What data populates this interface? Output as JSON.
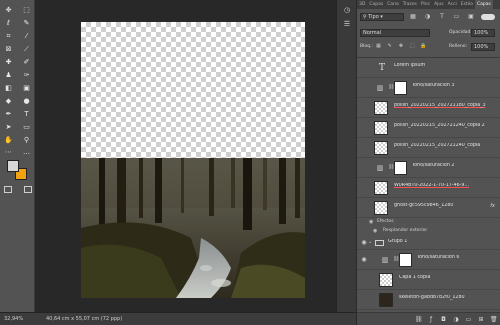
{
  "toolbar": {
    "tools": [
      "move",
      "marquee",
      "lasso",
      "quick-select",
      "crop",
      "eyedropper",
      "healing",
      "brush",
      "stamp",
      "history-brush",
      "eraser",
      "gradient",
      "blur",
      "dodge",
      "pen",
      "type",
      "path-select",
      "shape",
      "hand",
      "zoom",
      "more"
    ],
    "foreground_color": "#d8d8d8",
    "background_color": "#f2a30f"
  },
  "status": {
    "zoom": "32,94%",
    "dimensions": "40,64 cm x 55,07 cm (72 ppp)"
  },
  "panel": {
    "tabs": [
      "3D",
      "Capas",
      "Cana",
      "Trazos",
      "Pinc",
      "Ajus",
      "Acci",
      "Estilo",
      "Capas"
    ],
    "active_tab": "Capas",
    "filter_kind": "Tipo",
    "blend_mode": "Normal",
    "opacity_label": "Opacidad:",
    "opacity_value": "100%",
    "lock_label": "Bloq.:",
    "fill_label": "Relleno:",
    "fill_value": "100%"
  },
  "layers": [
    {
      "name": "Lorem Ipsum",
      "kind": "text"
    },
    {
      "name": "Tono/saturación 3",
      "kind": "adjustment"
    },
    {
      "name": "polish_20220215_202721180_copia_3",
      "kind": "image"
    },
    {
      "name": "polish_20220215_202721240_copia 2",
      "kind": "image"
    },
    {
      "name": "polish_20220215_202721240_copia",
      "kind": "image"
    },
    {
      "name": "Tono/saturación 2",
      "kind": "adjustment"
    },
    {
      "name": "W0R4BT0-2022-1-70-17-46-9...",
      "kind": "image"
    },
    {
      "name": "ghost-gc595c9846_1280",
      "kind": "image",
      "fx": "fx"
    },
    {
      "name": "Grupo 1",
      "kind": "group"
    },
    {
      "name": "Tono/saturación 6",
      "kind": "adjustment"
    },
    {
      "name": "Capa 1 copia",
      "kind": "image"
    },
    {
      "name": "skeleton-gabd87b2f0_1280",
      "kind": "dark-image"
    }
  ],
  "effects": {
    "label": "Efectos",
    "item": "Resplandor exterior"
  }
}
